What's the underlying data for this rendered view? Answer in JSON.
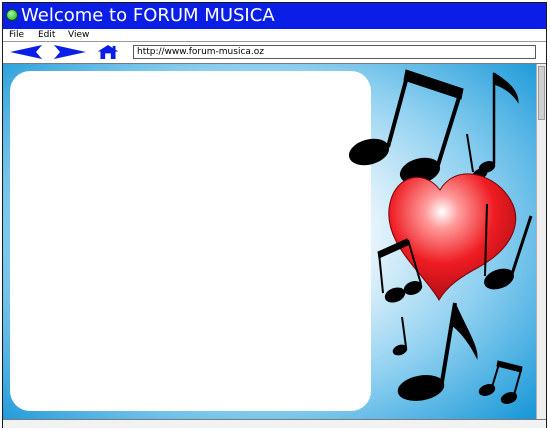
{
  "window": {
    "title": "Welcome to FORUM MUSICA"
  },
  "menu": {
    "file": "File",
    "edit": "Edit",
    "view": "View"
  },
  "toolbar": {
    "url": "http://www.forum-musica.oz"
  },
  "icons": {
    "back": "left-arrow-icon",
    "forward": "right-arrow-icon",
    "home": "home-icon",
    "title": "green-dot-icon"
  },
  "colors": {
    "titlebar": "#0a1ee6",
    "nav_icons": "#0a1ee6",
    "background_edge": "#1a98d8",
    "heart": "#e8141c"
  }
}
